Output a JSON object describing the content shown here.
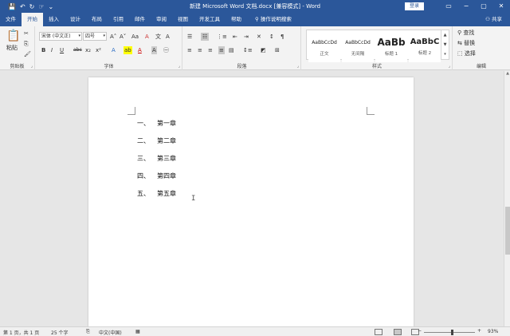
{
  "window": {
    "title": "新建 Microsoft Word 文档.docx [兼容模式] - Word",
    "login_label": "登录",
    "quick_access": [
      "💾",
      "↶",
      "↻",
      "☞",
      "⌄"
    ],
    "controls": [
      "▭",
      "−",
      "▢",
      "✕"
    ]
  },
  "tabs": [
    "文件",
    "开始",
    "插入",
    "设计",
    "布局",
    "引用",
    "邮件",
    "审阅",
    "视图",
    "开发工具",
    "帮助"
  ],
  "active_tab": "开始",
  "tell_me": "操作说明搜索",
  "share_label": "共享",
  "ribbon": {
    "clipboard": {
      "label": "剪贴板",
      "paste_label": "粘贴",
      "cut_icon": "scissors-icon",
      "copy_icon": "copy-icon",
      "format_painter_icon": "brush-icon"
    },
    "font": {
      "label": "字体",
      "font_name": "宋体 (中文正)",
      "font_size": "四号",
      "grow": "A˄",
      "shrink": "A˅",
      "case": "Aa",
      "clear": "A",
      "bold": "B",
      "italic": "I",
      "underline": "U",
      "strike": "abc",
      "subscript": "x₂",
      "superscript": "x²"
    },
    "paragraph": {
      "label": "段落"
    },
    "styles": {
      "label": "样式",
      "items": [
        {
          "sample": "AaBbCcDd",
          "name": "正文"
        },
        {
          "sample": "AaBbCcDd",
          "name": "无间隔"
        },
        {
          "sample": "AaBb",
          "name": "标题 1"
        },
        {
          "sample": "AaBbC",
          "name": "标题 2"
        }
      ]
    },
    "editing": {
      "label": "编辑",
      "find": "查找",
      "replace": "替换",
      "select": "选择"
    }
  },
  "document": {
    "items": [
      {
        "num": "一、",
        "text": "第一章"
      },
      {
        "num": "二、",
        "text": "第二章"
      },
      {
        "num": "三、",
        "text": "第三章"
      },
      {
        "num": "四、",
        "text": "第四章"
      },
      {
        "num": "五、",
        "text": "第五章"
      }
    ]
  },
  "status": {
    "page": "第 1 页，共 1 页",
    "words": "25 个字",
    "language": "中文(中国)",
    "zoom": "93%",
    "zoom_minus": "−",
    "zoom_plus": "+"
  }
}
